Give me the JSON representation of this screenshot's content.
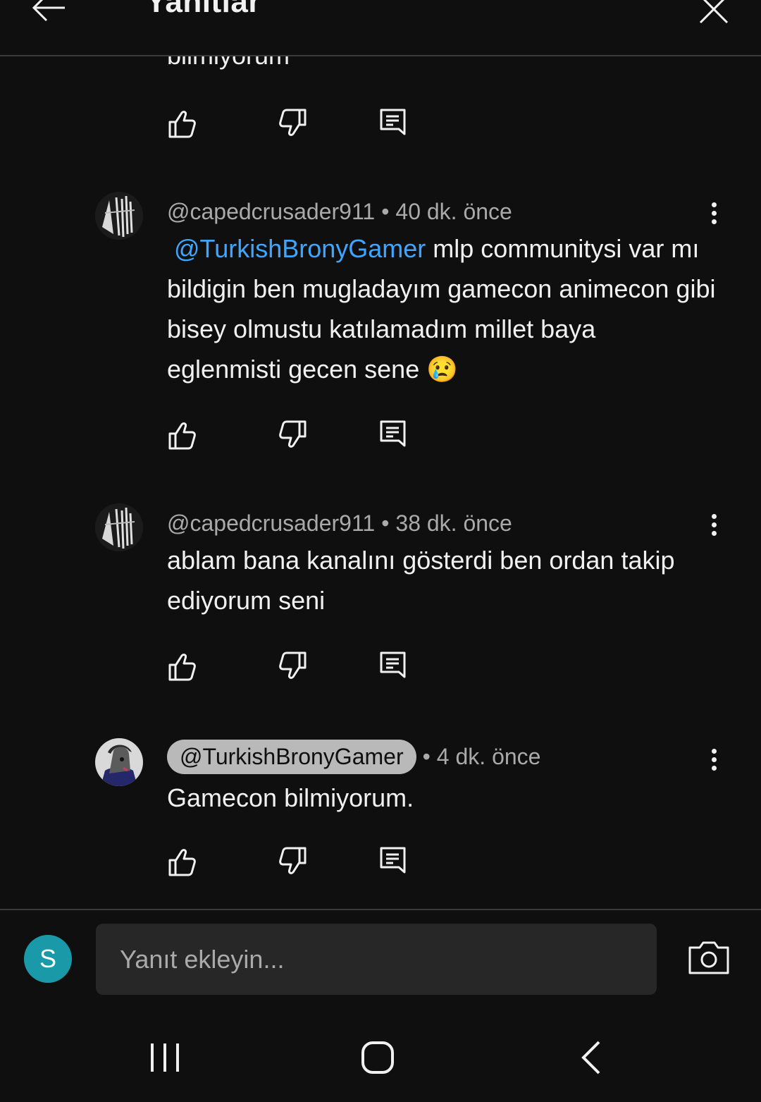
{
  "header": {
    "title": "Yanıtlar"
  },
  "clipped_text": "bilmiyorum",
  "comments": [
    {
      "author": "@capedcrusader911",
      "time": "40 dk. önce",
      "mention": "@TurkishBronyGamer",
      "text": " mlp communitysi var mı bildigin ben mugladayım gamecon animecon gibi bisey olmustu katılamadım millet baya eglenmisti gecen sene 😢"
    },
    {
      "author": "@capedcrusader911",
      "time": "38 dk. önce",
      "text": "ablam bana kanalını gösterdi ben ordan takip ediyorum seni"
    },
    {
      "author": "@TurkishBronyGamer",
      "time": "4 dk. önce",
      "text": "Gamecon bilmiyorum."
    }
  ],
  "separator": "•",
  "composer": {
    "user_initial": "S",
    "placeholder": "Yanıt ekleyin..."
  },
  "colors": {
    "background": "#0f0f0f",
    "mention": "#3ea6ff",
    "user_avatar": "#1a9aa8",
    "input_bg": "#272727"
  },
  "icons": [
    "arrow-left-icon",
    "close-icon",
    "thumbs-up-icon",
    "thumbs-down-icon",
    "reply-icon",
    "more-vert-icon",
    "camera-icon",
    "recent-apps-icon",
    "home-icon",
    "back-icon"
  ]
}
